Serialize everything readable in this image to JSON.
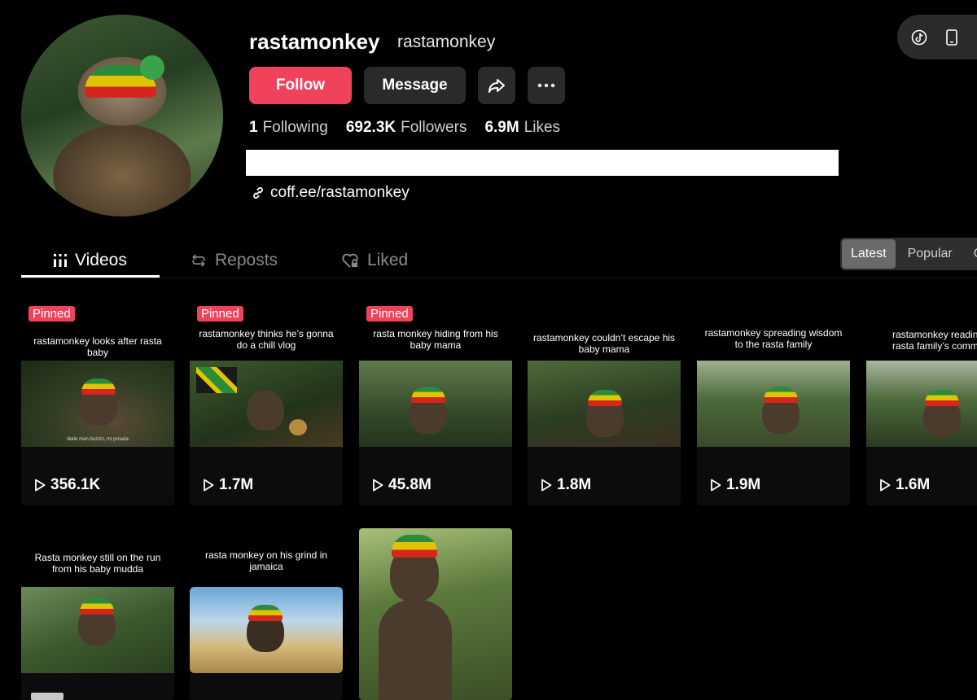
{
  "profile": {
    "username": "rastamonkey",
    "nickname": "rastamonkey",
    "follow_label": "Follow",
    "message_label": "Message",
    "stats": [
      {
        "value": "1",
        "label": "Following"
      },
      {
        "value": "692.3K",
        "label": "Followers"
      },
      {
        "value": "6.9M",
        "label": "Likes"
      }
    ],
    "link": "coff.ee/rastamonkey"
  },
  "tabs": [
    {
      "label": "Videos",
      "active": true
    },
    {
      "label": "Reposts",
      "active": false
    },
    {
      "label": "Liked",
      "active": false
    }
  ],
  "sort": [
    "Latest",
    "Popular",
    "O"
  ],
  "pinned_label": "Pinned",
  "videos": [
    {
      "caption": "rastamonkey looks after rasta baby",
      "views": "356.1K",
      "pinned": true,
      "subtitle": "likkle man buzzin, mi prouda"
    },
    {
      "caption": "rastamonkey thinks he’s gonna do a chill vlog",
      "views": "1.7M",
      "pinned": true
    },
    {
      "caption": "rasta monkey hiding from his baby mama",
      "views": "45.8M",
      "pinned": true
    },
    {
      "caption": "rastamonkey couldn’t escape his baby mama",
      "views": "1.8M",
      "pinned": false
    },
    {
      "caption": "rastamonkey spreading wisdom to the rasta family",
      "views": "1.9M",
      "pinned": false
    },
    {
      "caption": "rastamonkey reading rasta family’s comme",
      "views": "1.6M",
      "pinned": false
    },
    {
      "caption": "Rasta monkey still on the run from his baby mudda",
      "views": "",
      "pinned": false
    },
    {
      "caption": "rasta monkey on his grind in jamaica",
      "views": "",
      "pinned": false
    },
    {
      "caption": "",
      "views": "",
      "pinned": false
    }
  ],
  "colors": {
    "accent": "#f0435b",
    "button_dark": "#2a2a2a",
    "background": "#000000"
  }
}
